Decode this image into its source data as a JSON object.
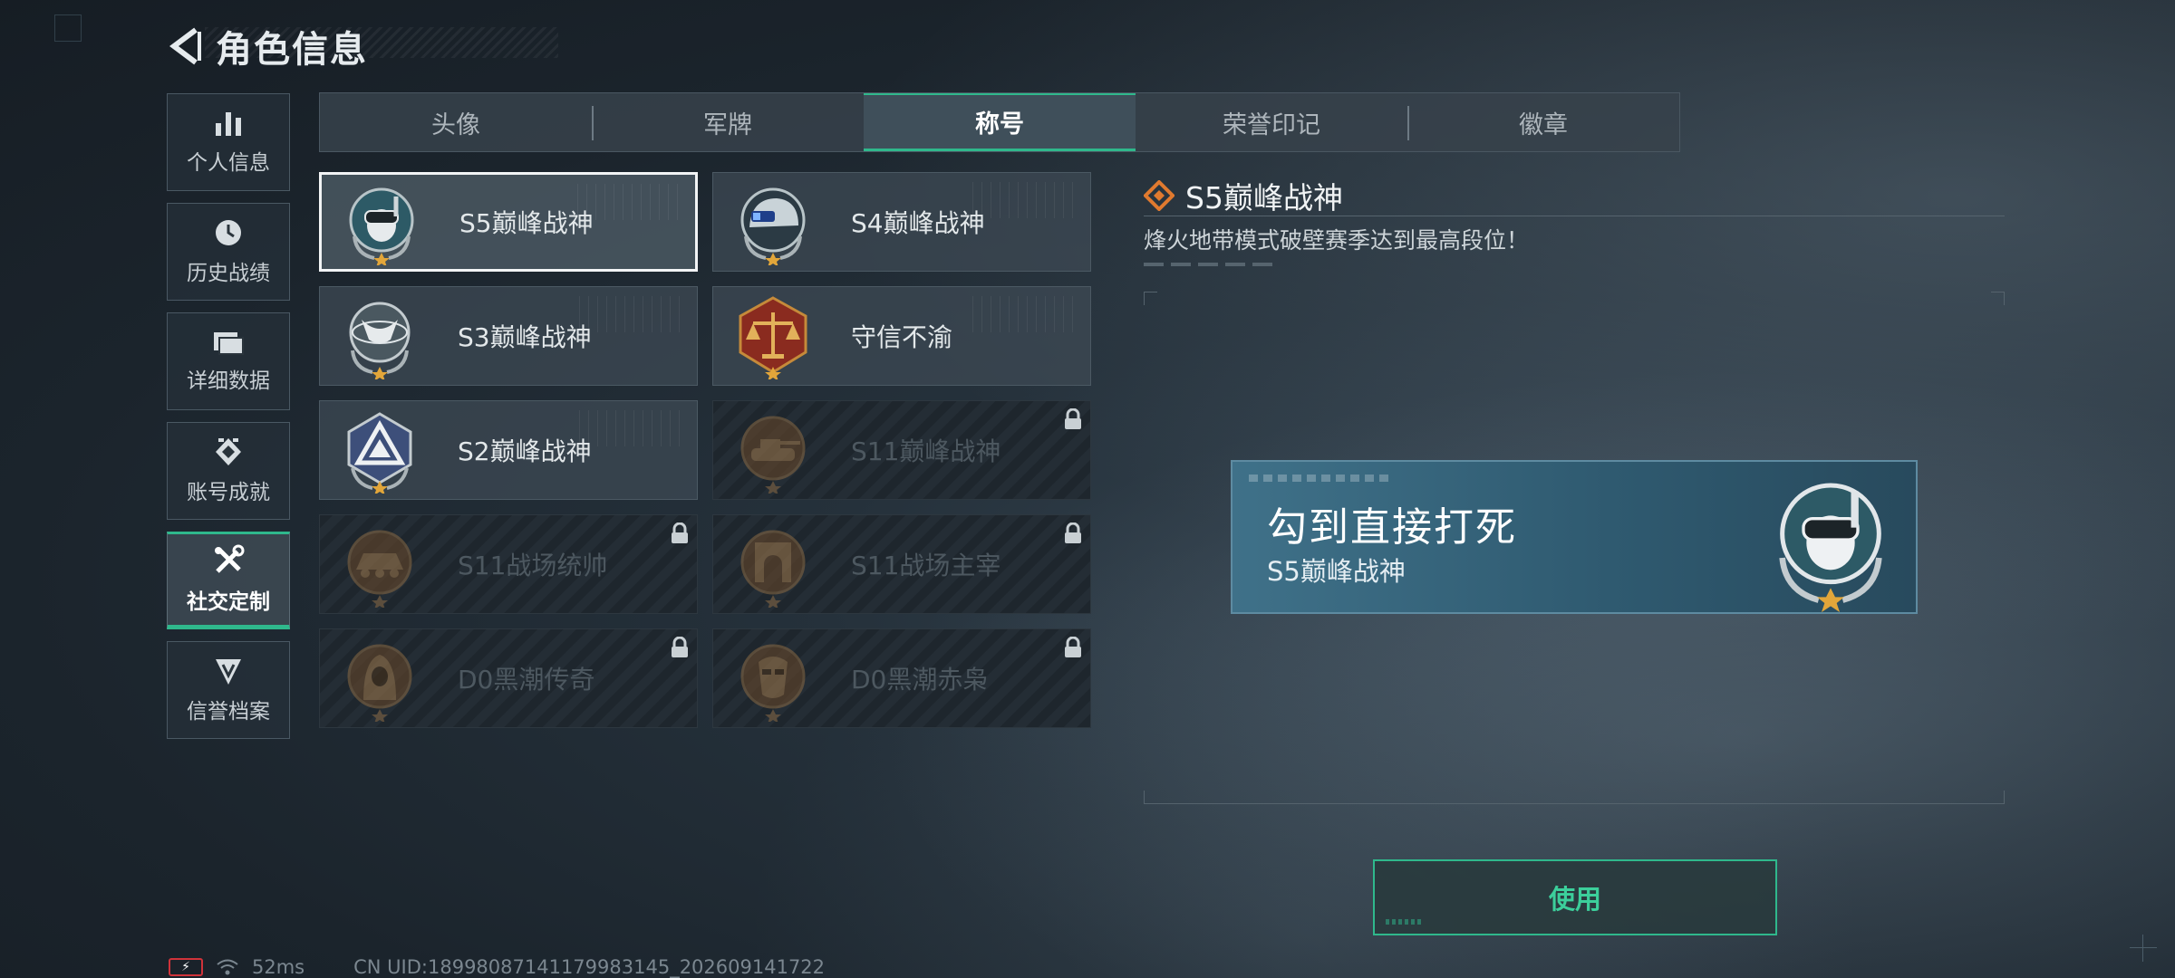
{
  "header": {
    "title": "角色信息"
  },
  "sidebar": {
    "items": [
      {
        "label": "个人信息",
        "icon": "bar-chart-icon"
      },
      {
        "label": "历史战绩",
        "icon": "clock-icon"
      },
      {
        "label": "详细数据",
        "icon": "folder-icon"
      },
      {
        "label": "账号成就",
        "icon": "achievement-icon"
      },
      {
        "label": "社交定制",
        "icon": "tools-icon",
        "active": true
      },
      {
        "label": "信誉档案",
        "icon": "reputation-icon"
      }
    ]
  },
  "tabs": [
    {
      "label": "头像"
    },
    {
      "label": "军牌"
    },
    {
      "label": "称号",
      "active": true
    },
    {
      "label": "荣誉印记"
    },
    {
      "label": "徽章"
    }
  ],
  "titles": [
    {
      "name": "S5巅峰战神",
      "medal": "diver-skull-medal",
      "selected": true,
      "locked": false
    },
    {
      "name": "S4巅峰战神",
      "medal": "helmet-medal",
      "selected": false,
      "locked": false
    },
    {
      "name": "S3巅峰战神",
      "medal": "globe-eagle-medal",
      "selected": false,
      "locked": false
    },
    {
      "name": "守信不渝",
      "medal": "scales-medal",
      "selected": false,
      "locked": false
    },
    {
      "name": "S2巅峰战神",
      "medal": "triangle-emblem-medal",
      "selected": false,
      "locked": false
    },
    {
      "name": "S11巅峰战神",
      "medal": "tank-medal",
      "selected": false,
      "locked": true
    },
    {
      "name": "S11战场统帅",
      "medal": "apc-medal",
      "selected": false,
      "locked": true
    },
    {
      "name": "S11战场主宰",
      "medal": "arch-medal",
      "selected": false,
      "locked": true
    },
    {
      "name": "D0黑潮传奇",
      "medal": "hooded-figure-medal",
      "selected": false,
      "locked": true
    },
    {
      "name": "D0黑潮赤枭",
      "medal": "mask-medal",
      "selected": false,
      "locked": true
    }
  ],
  "detail": {
    "title": "S5巅峰战神",
    "description": "烽火地带模式破壁赛季达到最高段位！",
    "preview_nickname": "勾到直接打死",
    "preview_title": "S5巅峰战神",
    "use_label": "使用"
  },
  "status": {
    "ping": "52ms",
    "uid": "CN UID:18998087141179983145_202609141722"
  },
  "colors": {
    "accent": "#2fb88c",
    "battery_low": "#d0333a",
    "medal_bronze": "#8a5a2b"
  }
}
